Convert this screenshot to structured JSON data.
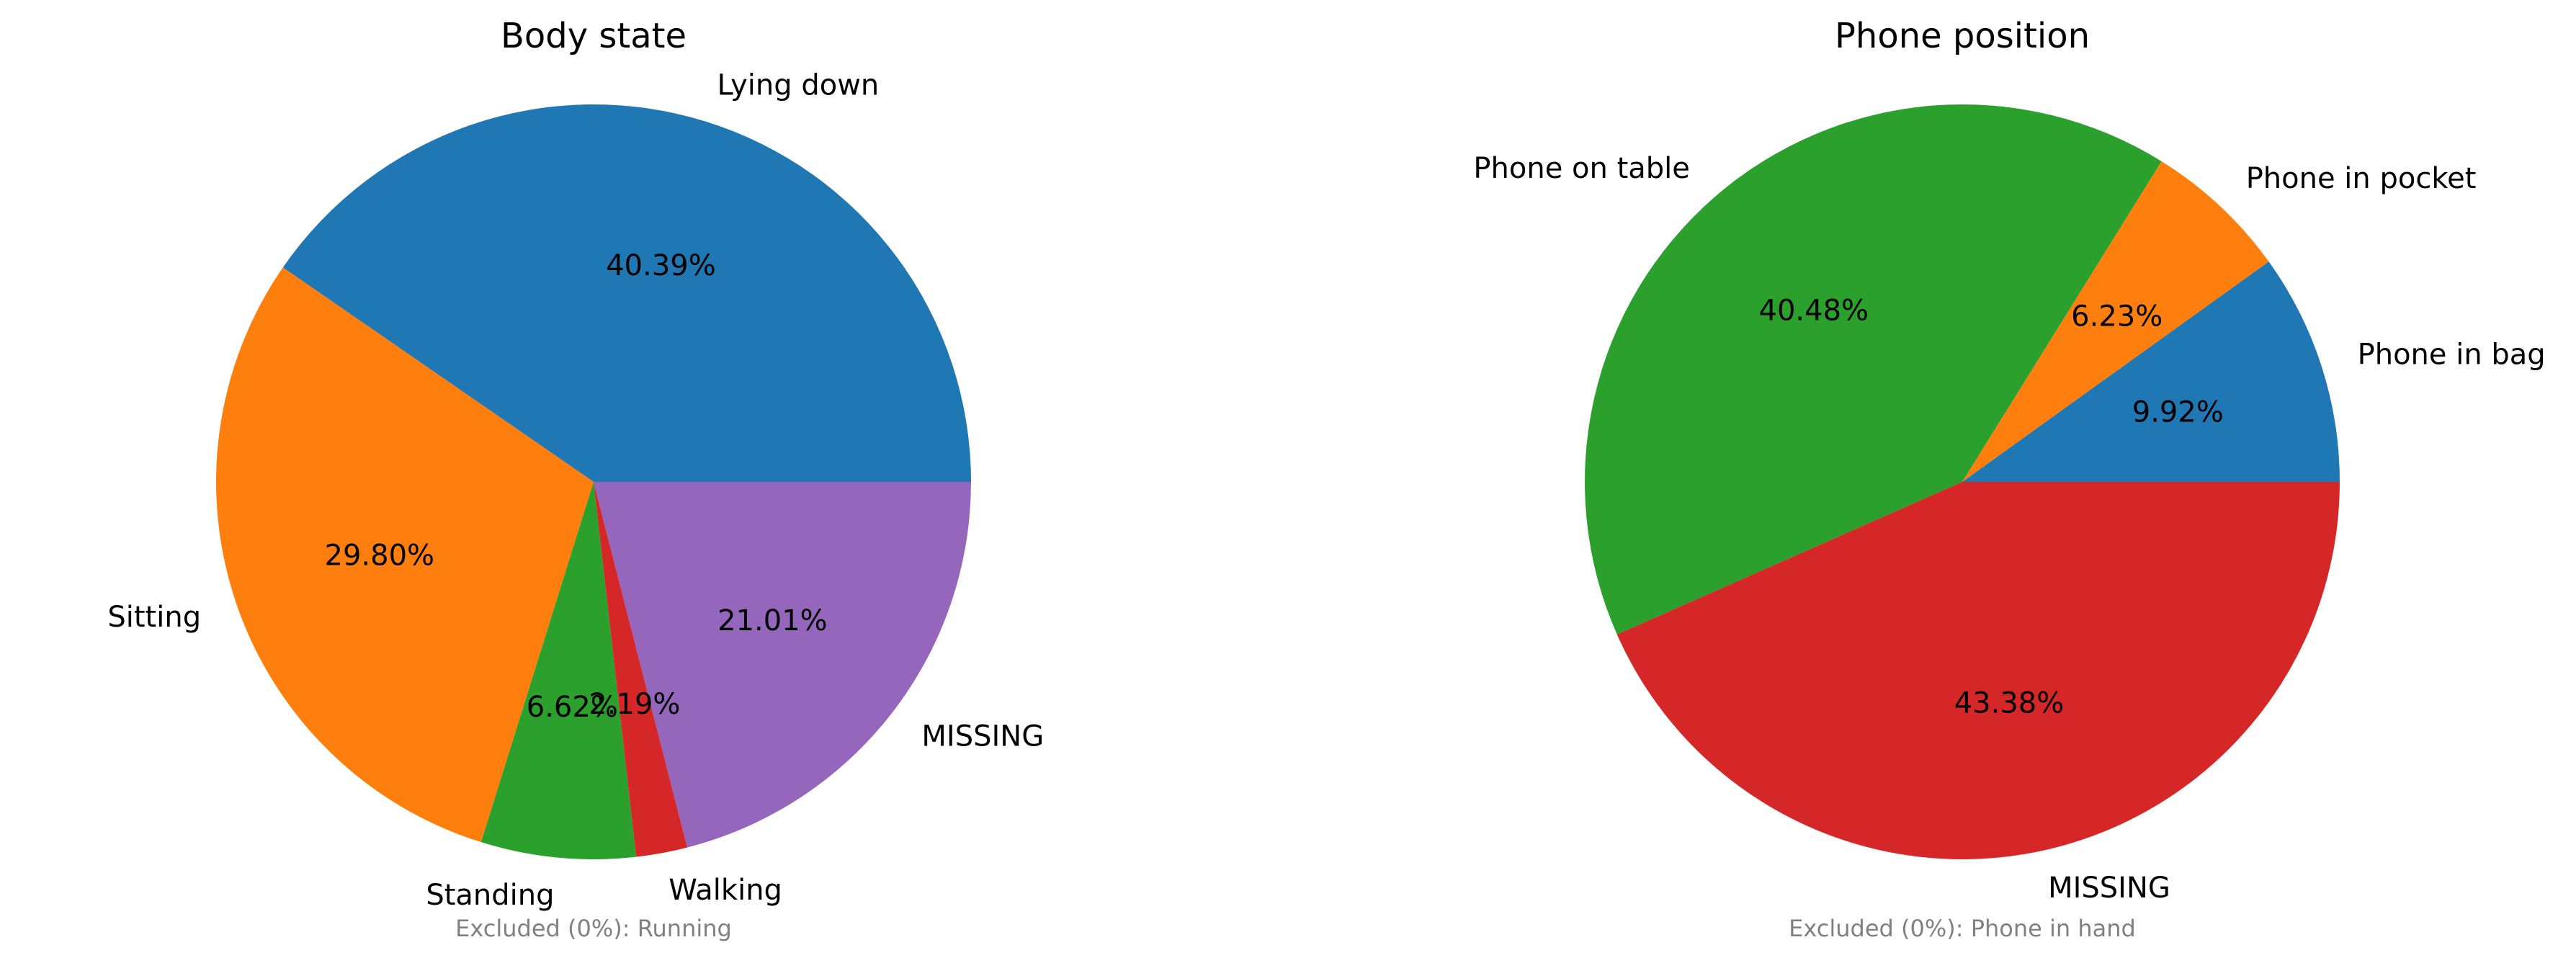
{
  "chart_data": [
    {
      "type": "pie",
      "title": "Body state",
      "start_angle_deg": 0,
      "direction": "counterclockwise",
      "slices": [
        {
          "label": "Lying down",
          "value": 40.39,
          "display": "40.39%",
          "color": "#1f77b4"
        },
        {
          "label": "Sitting",
          "value": 29.8,
          "display": "29.80%",
          "color": "#ff7f0e"
        },
        {
          "label": "Standing",
          "value": 6.62,
          "display": "6.62%",
          "color": "#2ca02c"
        },
        {
          "label": "Walking",
          "value": 2.19,
          "display": "2.19%",
          "color": "#d62728"
        },
        {
          "label": "MISSING",
          "value": 21.01,
          "display": "21.01%",
          "color": "#9467bd"
        }
      ],
      "note": "Excluded (0%): Running"
    },
    {
      "type": "pie",
      "title": "Phone position",
      "start_angle_deg": 0,
      "direction": "counterclockwise",
      "slices": [
        {
          "label": "Phone in bag",
          "value": 9.92,
          "display": "9.92%",
          "color": "#1f77b4"
        },
        {
          "label": "Phone in pocket",
          "value": 6.23,
          "display": "6.23%",
          "color": "#ff7f0e"
        },
        {
          "label": "Phone on table",
          "value": 40.48,
          "display": "40.48%",
          "color": "#2ca02c"
        },
        {
          "label": "MISSING",
          "value": 43.38,
          "display": "43.38%",
          "color": "#d62728"
        }
      ],
      "note": "Excluded (0%): Phone in hand"
    }
  ]
}
